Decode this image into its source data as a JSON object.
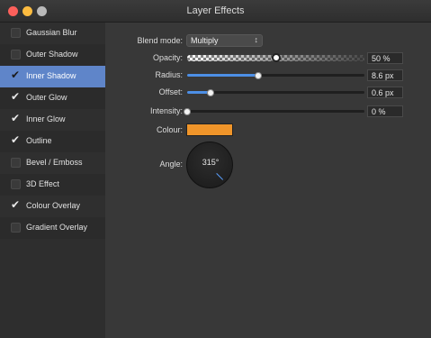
{
  "window": {
    "title": "Layer Effects"
  },
  "sidebar": {
    "items": [
      {
        "label": "Gaussian Blur",
        "checked": false,
        "selected": false
      },
      {
        "label": "Outer Shadow",
        "checked": false,
        "selected": false
      },
      {
        "label": "Inner Shadow",
        "checked": true,
        "selected": true
      },
      {
        "label": "Outer Glow",
        "checked": true,
        "selected": false
      },
      {
        "label": "Inner Glow",
        "checked": true,
        "selected": false
      },
      {
        "label": "Outline",
        "checked": true,
        "selected": false
      },
      {
        "label": "Bevel / Emboss",
        "checked": false,
        "selected": false
      },
      {
        "label": "3D Effect",
        "checked": false,
        "selected": false
      },
      {
        "label": "Colour Overlay",
        "checked": true,
        "selected": false
      },
      {
        "label": "Gradient Overlay",
        "checked": false,
        "selected": false
      }
    ]
  },
  "settings": {
    "blend_mode_label": "Blend mode:",
    "blend_mode_value": "Multiply",
    "opacity_label": "Opacity:",
    "opacity_value": "50 %",
    "opacity_fraction": 0.5,
    "radius_label": "Radius:",
    "radius_value": "8.6 px",
    "radius_fraction": 0.4,
    "offset_label": "Offset:",
    "offset_value": "0.6 px",
    "offset_fraction": 0.13,
    "intensity_label": "Intensity:",
    "intensity_value": "0 %",
    "intensity_fraction": 0.0,
    "colour_label": "Colour:",
    "colour_hex": "#f0952a",
    "angle_label": "Angle:",
    "angle_value": "315°"
  },
  "colors": {
    "accent": "#5f85c9",
    "slider_fill": "#4d8fe6"
  }
}
